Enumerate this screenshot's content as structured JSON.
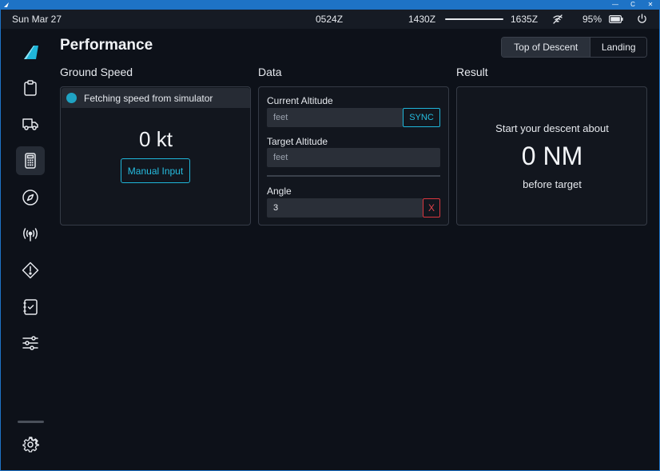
{
  "status_bar": {
    "date": "Sun Mar 27",
    "utc_time": "0524Z",
    "departure_time": "1430Z",
    "arrival_time": "1635Z",
    "battery": "95%",
    "icons": [
      "signal-off-icon",
      "battery-icon",
      "power-icon"
    ]
  },
  "window": {
    "controls": [
      "—",
      "C",
      "✕"
    ]
  },
  "sidebar": {
    "logo": "flypad-logo",
    "items": [
      {
        "name": "dispatch",
        "icon": "clipboard-icon",
        "active": false
      },
      {
        "name": "ground",
        "icon": "truck-icon",
        "active": false
      },
      {
        "name": "performance",
        "icon": "calculator-icon",
        "active": true
      },
      {
        "name": "navigation",
        "icon": "compass-icon",
        "active": false
      },
      {
        "name": "atc",
        "icon": "broadcast-icon",
        "active": false
      },
      {
        "name": "failures",
        "icon": "warning-icon",
        "active": false
      },
      {
        "name": "checklists",
        "icon": "checklist-icon",
        "active": false
      },
      {
        "name": "presets",
        "icon": "sliders-icon",
        "active": false
      }
    ],
    "settings_icon": "gear-icon"
  },
  "page": {
    "title": "Performance",
    "tabs": [
      {
        "label": "Top of Descent",
        "selected": true
      },
      {
        "label": "Landing",
        "selected": false
      }
    ]
  },
  "ground_speed": {
    "title": "Ground Speed",
    "banner": "Fetching speed from simulator",
    "value": "0 kt",
    "manual_button": "Manual Input"
  },
  "data": {
    "title": "Data",
    "current_altitude_label": "Current Altitude",
    "current_altitude_placeholder": "feet",
    "sync_button": "SYNC",
    "target_altitude_label": "Target Altitude",
    "target_altitude_placeholder": "feet",
    "angle_label": "Angle",
    "angle_value": "3",
    "clear_button": "X"
  },
  "result": {
    "title": "Result",
    "line1": "Start your descent about",
    "value": "0 NM",
    "line2": "before target"
  },
  "colors": {
    "background": "#0d1119",
    "accent": "#1fb6da",
    "danger": "#d9363e",
    "titlebar": "#1e73c6"
  }
}
